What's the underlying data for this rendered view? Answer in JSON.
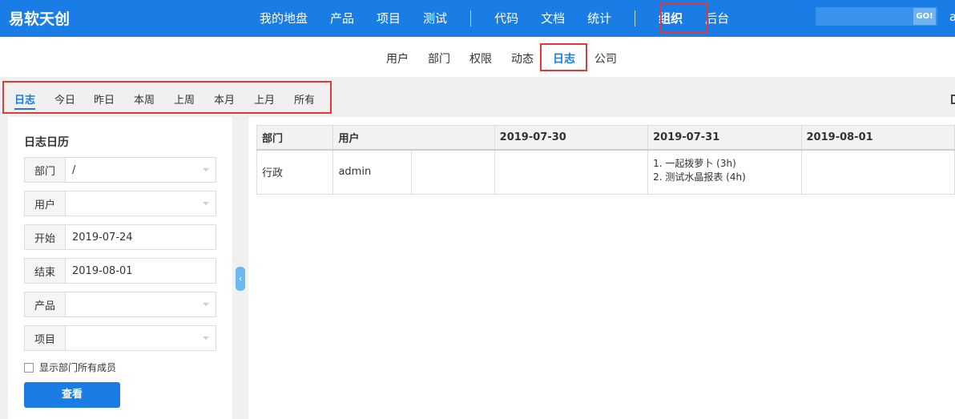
{
  "header": {
    "brand": "易软天创",
    "nav": [
      "我的地盘",
      "产品",
      "项目",
      "测试",
      "代码",
      "文档",
      "统计",
      "组织",
      "后台"
    ],
    "search_button": "GO!",
    "user_initial": "a"
  },
  "subnav": {
    "items": [
      "用户",
      "部门",
      "权限",
      "动态",
      "日志",
      "公司"
    ],
    "active": "日志"
  },
  "filters": {
    "items": [
      "日志",
      "今日",
      "昨日",
      "本周",
      "上周",
      "本月",
      "上月",
      "所有"
    ],
    "active": "日志"
  },
  "sidebar": {
    "title": "日志日历",
    "fields": [
      {
        "label": "部门",
        "value": "/"
      },
      {
        "label": "用户",
        "value": ""
      },
      {
        "label": "开始",
        "value": "2019-07-24"
      },
      {
        "label": "结束",
        "value": "2019-08-01"
      },
      {
        "label": "产品",
        "value": ""
      },
      {
        "label": "项目",
        "value": ""
      }
    ],
    "checkbox_label": "显示部门所有成员",
    "view_button": "查看",
    "collapse_glyph": "‹"
  },
  "table": {
    "headers": [
      "部门",
      "用户",
      "",
      "2019-07-30",
      "2019-07-31",
      "2019-08-01"
    ],
    "rows": [
      {
        "dept": "行政",
        "user": "admin",
        "blank": "",
        "d0730": "",
        "d0731": [
          "1. 一起拨萝卜 (3h)",
          "2. 测试水晶报表 (4h)"
        ],
        "d0801": ""
      }
    ]
  },
  "colors": {
    "accent": "#1a7de5",
    "highlight": "#e53935"
  }
}
